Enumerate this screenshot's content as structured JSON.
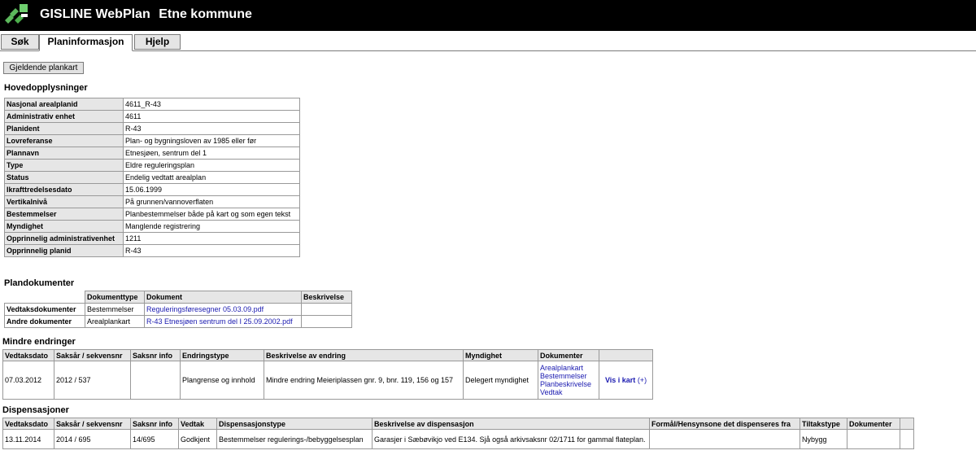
{
  "app": {
    "name": "GISLINE WebPlan",
    "municipality": "Etne kommune"
  },
  "tabs": [
    "Søk",
    "Planinformasjon",
    "Hjelp"
  ],
  "map_button": "Gjeldende plankart",
  "main": {
    "heading": "Hovedopplysninger",
    "rows": [
      {
        "label": "Nasjonal arealplanid",
        "value": "4611_R-43"
      },
      {
        "label": "Administrativ enhet",
        "value": "4611"
      },
      {
        "label": "Planident",
        "value": "R-43"
      },
      {
        "label": "Lovreferanse",
        "value": "Plan- og bygningsloven av 1985 eller før"
      },
      {
        "label": "Plannavn",
        "value": "Etnesjøen, sentrum del 1"
      },
      {
        "label": "Type",
        "value": "Eldre reguleringsplan"
      },
      {
        "label": "Status",
        "value": "Endelig vedtatt arealplan"
      },
      {
        "label": "Ikrafttredelsesdato",
        "value": "15.06.1999"
      },
      {
        "label": "Vertikalnivå",
        "value": "På grunnen/vannoverflaten"
      },
      {
        "label": "Bestemmelser",
        "value": "Planbestemmelser både på kart og som egen tekst"
      },
      {
        "label": "Myndighet",
        "value": "Manglende registrering"
      },
      {
        "label": "Opprinnelig administrativenhet",
        "value": "1211"
      },
      {
        "label": "Opprinnelig planid",
        "value": "R-43"
      }
    ]
  },
  "documents": {
    "heading": "Plandokumenter",
    "headers": [
      "",
      "Dokumenttype",
      "Dokument",
      "Beskrivelse"
    ],
    "rows": [
      {
        "group": "Vedtaksdokumenter",
        "type": "Bestemmelser",
        "doc": "Reguleringsføresegner 05.03.09.pdf",
        "desc": ""
      },
      {
        "group": "Andre dokumenter",
        "type": "Arealplankart",
        "doc": "R-43 Etnesjøen sentrum del I 25.09.2002.pdf",
        "desc": ""
      }
    ]
  },
  "changes": {
    "heading": "Mindre endringer",
    "headers": [
      "Vedtaksdato",
      "Saksår / sekvensnr",
      "Saksnr info",
      "Endringstype",
      "Beskrivelse av endring",
      "Myndighet",
      "Dokumenter",
      ""
    ],
    "row": {
      "date": "07.03.2012",
      "case": "2012 / 537",
      "info": "",
      "type": "Plangrense og innhold",
      "desc": "Mindre endring Meieriplassen gnr. 9, bnr. 119, 156 og 157",
      "authority": "Delegert myndighet",
      "docs": [
        "Arealplankart",
        "Bestemmelser",
        "Planbeskrivelse",
        "Vedtak"
      ],
      "map_link": "Vis i kart",
      "map_plus": "(+)"
    }
  },
  "dispensations": {
    "heading": "Dispensasjoner",
    "headers": [
      "Vedtaksdato",
      "Saksår / sekvensnr",
      "Saksnr info",
      "Vedtak",
      "Dispensasjonstype",
      "Beskrivelse av dispensasjon",
      "Formål/Hensynsone det dispenseres fra",
      "Tiltakstype",
      "Dokumenter",
      ""
    ],
    "row": {
      "date": "13.11.2014",
      "case": "2014 / 695",
      "info": "14/695",
      "decision": "Godkjent",
      "type": "Bestemmelser regulerings-/bebyggelsesplan",
      "desc": "Garasjer i Sæbøvikjo ved E134. Sjå også arkivsaksnr 02/1711 for gammal flateplan.",
      "purpose": "",
      "measure": "Nybygg",
      "docs": ""
    }
  },
  "colors": {
    "topbar": "#000000",
    "logo": "#4caf50",
    "link": "#1a1ab0",
    "header_bg": "#e6e6e6"
  }
}
